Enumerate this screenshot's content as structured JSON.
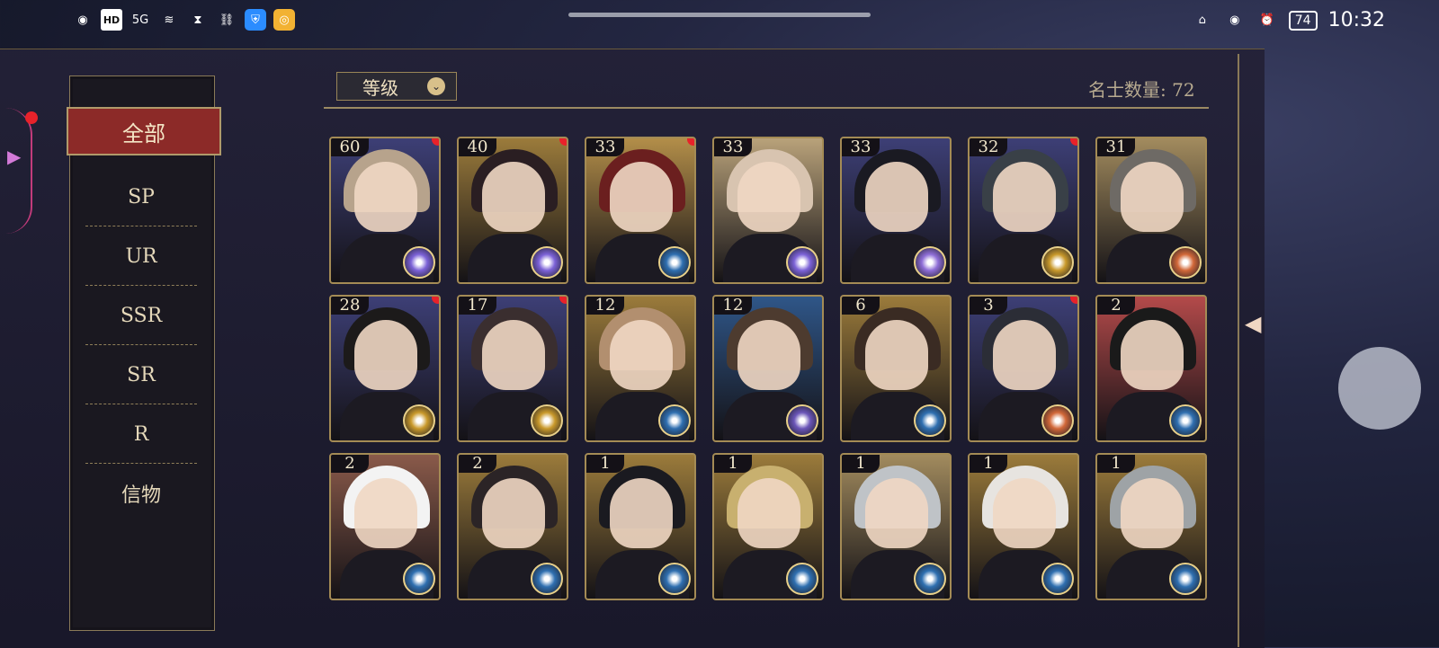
{
  "status_bar": {
    "left_icons": [
      "swirl-icon",
      "hd-icon",
      "signal-5g-icon",
      "wifi-icon",
      "hourglass-icon",
      "link-icon",
      "shield-app-icon",
      "weibo-icon"
    ],
    "hd_label": "HD",
    "signal_label": "5G",
    "battery": "74",
    "time": "10:32"
  },
  "sidebar": {
    "active": "全部",
    "items": [
      "SP",
      "UR",
      "SSR",
      "SR",
      "R",
      "信物"
    ]
  },
  "toolbar": {
    "sort_label": "等级",
    "count_label": "名士数量: 72"
  },
  "cards": [
    {
      "level": "60",
      "has_dot": true,
      "emblem": "#7c62d7",
      "bg": "#3d3f76",
      "hair": "#b7a38c"
    },
    {
      "level": "40",
      "has_dot": true,
      "emblem": "#7c62d7",
      "bg": "#9b7b3b",
      "hair": "#2a1e22"
    },
    {
      "level": "33",
      "has_dot": true,
      "emblem": "#2f6fb0",
      "bg": "#b38e49",
      "hair": "#6b1f1f"
    },
    {
      "level": "33",
      "has_dot": false,
      "emblem": "#7c62d7",
      "bg": "#b9a27a",
      "hair": "#d8c4b0"
    },
    {
      "level": "33",
      "has_dot": false,
      "emblem": "#8f6ed7",
      "bg": "#3d3f76",
      "hair": "#1a1a22"
    },
    {
      "level": "32",
      "has_dot": true,
      "emblem": "#c9992b",
      "bg": "#3d3f76",
      "hair": "#394047"
    },
    {
      "level": "31",
      "has_dot": false,
      "emblem": "#d26839",
      "bg": "#a28b5e",
      "hair": "#6e6a65"
    },
    {
      "level": "28",
      "has_dot": true,
      "emblem": "#c9992b",
      "bg": "#3d3f76",
      "hair": "#1c1a1a"
    },
    {
      "level": "17",
      "has_dot": true,
      "emblem": "#c9992b",
      "bg": "#3d3f76",
      "hair": "#3a2e2f"
    },
    {
      "level": "12",
      "has_dot": false,
      "emblem": "#2f6fb0",
      "bg": "#9b7b3b",
      "hair": "#b28f6f"
    },
    {
      "level": "12",
      "has_dot": false,
      "emblem": "#6b56b8",
      "bg": "#2f5688",
      "hair": "#4d3b2f"
    },
    {
      "level": "6",
      "has_dot": false,
      "emblem": "#2f6fb0",
      "bg": "#9b7b3b",
      "hair": "#3a2b23"
    },
    {
      "level": "3",
      "has_dot": true,
      "emblem": "#d26839",
      "bg": "#3d3f76",
      "hair": "#2b2d36"
    },
    {
      "level": "2",
      "has_dot": false,
      "emblem": "#2f6fb0",
      "bg": "#b44a4a",
      "hair": "#1a1a1a"
    },
    {
      "level": "2",
      "has_dot": false,
      "emblem": "#2f6fb0",
      "bg": "#8a5a4a",
      "hair": "#f3f3f3"
    },
    {
      "level": "2",
      "has_dot": false,
      "emblem": "#2f6fb0",
      "bg": "#9b7b3b",
      "hair": "#2b2426"
    },
    {
      "level": "1",
      "has_dot": false,
      "emblem": "#2f6fb0",
      "bg": "#9b7b3b",
      "hair": "#1a1a20"
    },
    {
      "level": "1",
      "has_dot": false,
      "emblem": "#2f6fb0",
      "bg": "#9b7b3b",
      "hair": "#c8b06f"
    },
    {
      "level": "1",
      "has_dot": false,
      "emblem": "#2f6fb0",
      "bg": "#a28b5e",
      "hair": "#bfc3c7"
    },
    {
      "level": "1",
      "has_dot": false,
      "emblem": "#2f6fb0",
      "bg": "#9b7b3b",
      "hair": "#e7e4e0"
    },
    {
      "level": "1",
      "has_dot": false,
      "emblem": "#2f6fb0",
      "bg": "#9b7b3b",
      "hair": "#9ea3a6"
    }
  ],
  "colors": {
    "accent": "#8c2a28",
    "gold": "#a48b55",
    "notify": "#e8222a"
  }
}
